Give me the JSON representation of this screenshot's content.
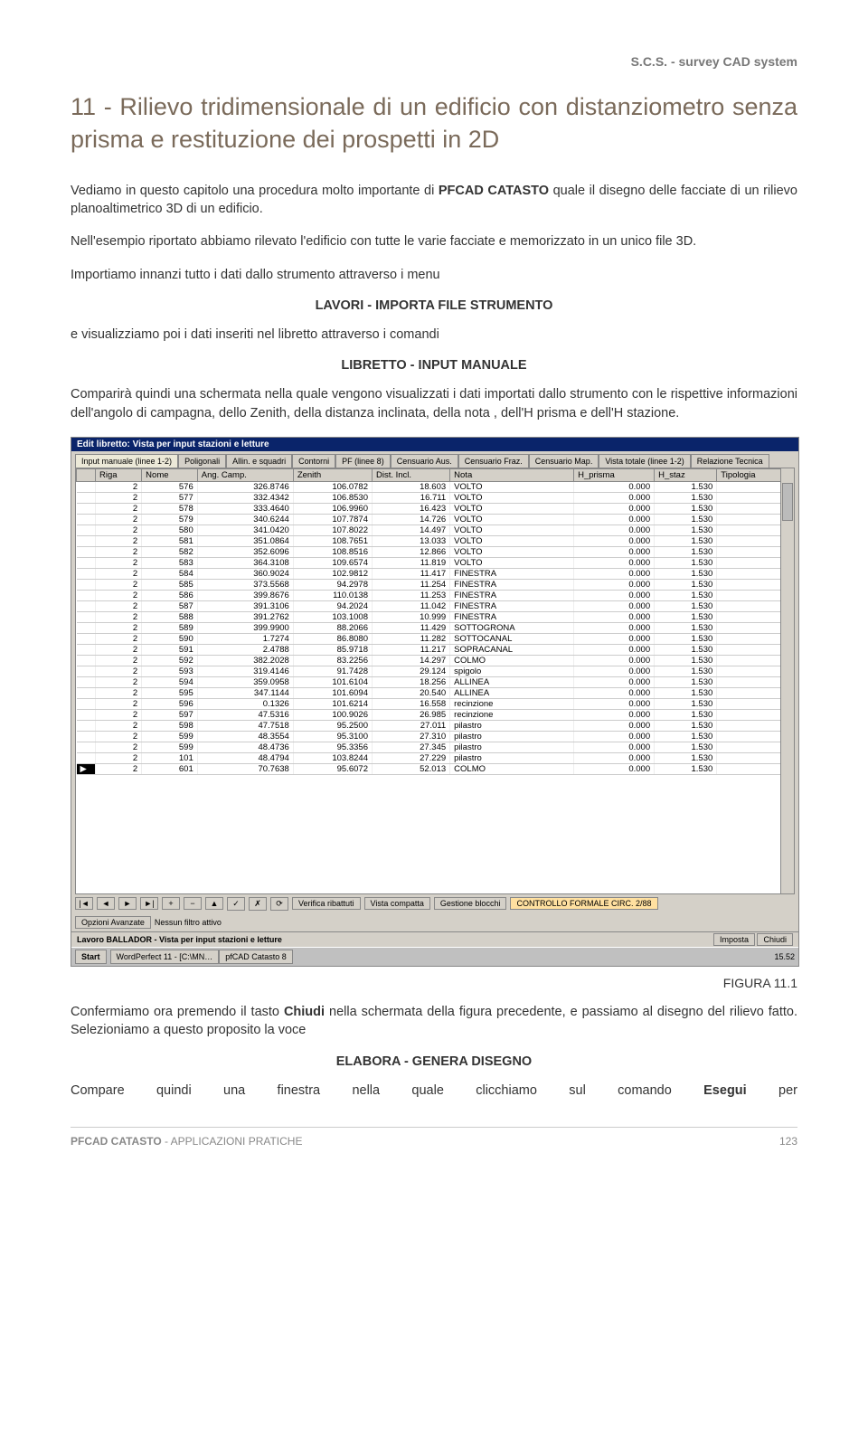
{
  "header": "S.C.S. - survey CAD system",
  "title": "11 - Rilievo tridimensionale di un edificio con distanziometro senza prisma e restituzione dei prospetti in 2D",
  "para1_a": "Vediamo in questo capitolo una procedura molto importante di ",
  "para1_b": "PFCAD CATASTO",
  "para1_c": " quale il disegno delle facciate di un rilievo planoaltimetrico 3D di un edificio.",
  "para2": "Nell'esempio riportato abbiamo rilevato l'edificio con tutte le varie facciate e memorizzato in un unico file 3D.",
  "para3": "Importiamo innanzi tutto i dati dallo strumento attraverso i menu",
  "center1": "LAVORI - IMPORTA FILE STRUMENTO",
  "para4": "e visualizziamo poi i dati inseriti nel libretto attraverso i comandi",
  "center2": "LIBRETTO - INPUT MANUALE",
  "para5": "Comparirà quindi una schermata nella quale vengono visualizzati i dati importati dallo strumento con le rispettive informazioni dell'angolo di campagna, dello Zenith, della distanza inclinata, della nota , dell'H prisma e dell'H stazione.",
  "figure_caption": "FIGURA 11.1",
  "para6_a": "Confermiamo ora premendo il tasto ",
  "para6_b": "Chiudi",
  "para6_c": " nella schermata della figura precedente, e passiamo al disegno del rilievo fatto.  Selezioniamo a questo proposito la voce",
  "center3": "ELABORA - GENERA DISEGNO",
  "para7_a": "Compare quindi una finestra nella quale clicchiamo sul comando ",
  "para7_b": "Esegui",
  "para7_c": " per",
  "footer_left_a": "PFCAD CATASTO",
  "footer_left_b": " - APPLICAZIONI PRATICHE",
  "footer_right": "123",
  "screenshot": {
    "window_title": "Edit libretto: Vista per input stazioni e letture",
    "tabs": [
      "Input manuale (linee 1-2)",
      "Poligonali",
      "Allin. e squadri",
      "Contorni",
      "PF (linee 8)",
      "Censuario Aus.",
      "Censuario Fraz.",
      "Censuario Map.",
      "Vista totale (linee 1-2)",
      "Relazione Tecnica"
    ],
    "columns": [
      "Riga",
      "Nome",
      "Ang. Camp.",
      "Zenith",
      "Dist. Incl.",
      "Nota",
      "H_prisma",
      "H_staz",
      "Tipologia"
    ],
    "rows": [
      [
        "2",
        "576",
        "326.8746",
        "106.0782",
        "18.603",
        "VOLTO",
        "0.000",
        "1.530",
        ""
      ],
      [
        "2",
        "577",
        "332.4342",
        "106.8530",
        "16.711",
        "VOLTO",
        "0.000",
        "1.530",
        ""
      ],
      [
        "2",
        "578",
        "333.4640",
        "106.9960",
        "16.423",
        "VOLTO",
        "0.000",
        "1.530",
        ""
      ],
      [
        "2",
        "579",
        "340.6244",
        "107.7874",
        "14.726",
        "VOLTO",
        "0.000",
        "1.530",
        ""
      ],
      [
        "2",
        "580",
        "341.0420",
        "107.8022",
        "14.497",
        "VOLTO",
        "0.000",
        "1.530",
        ""
      ],
      [
        "2",
        "581",
        "351.0864",
        "108.7651",
        "13.033",
        "VOLTO",
        "0.000",
        "1.530",
        ""
      ],
      [
        "2",
        "582",
        "352.6096",
        "108.8516",
        "12.866",
        "VOLTO",
        "0.000",
        "1.530",
        ""
      ],
      [
        "2",
        "583",
        "364.3108",
        "109.6574",
        "11.819",
        "VOLTO",
        "0.000",
        "1.530",
        ""
      ],
      [
        "2",
        "584",
        "360.9024",
        "102.9812",
        "11.417",
        "FINESTRA",
        "0.000",
        "1.530",
        ""
      ],
      [
        "2",
        "585",
        "373.5568",
        "94.2978",
        "11.254",
        "FINESTRA",
        "0.000",
        "1.530",
        ""
      ],
      [
        "2",
        "586",
        "399.8676",
        "110.0138",
        "11.253",
        "FINESTRA",
        "0.000",
        "1.530",
        ""
      ],
      [
        "2",
        "587",
        "391.3106",
        "94.2024",
        "11.042",
        "FINESTRA",
        "0.000",
        "1.530",
        ""
      ],
      [
        "2",
        "588",
        "391.2762",
        "103.1008",
        "10.999",
        "FINESTRA",
        "0.000",
        "1.530",
        ""
      ],
      [
        "2",
        "589",
        "399.9900",
        "88.2066",
        "11.429",
        "SOTTOGRONA",
        "0.000",
        "1.530",
        ""
      ],
      [
        "2",
        "590",
        "1.7274",
        "86.8080",
        "11.282",
        "SOTTOCANAL",
        "0.000",
        "1.530",
        ""
      ],
      [
        "2",
        "591",
        "2.4788",
        "85.9718",
        "11.217",
        "SOPRACANAL",
        "0.000",
        "1.530",
        ""
      ],
      [
        "2",
        "592",
        "382.2028",
        "83.2256",
        "14.297",
        "COLMO",
        "0.000",
        "1.530",
        ""
      ],
      [
        "2",
        "593",
        "319.4146",
        "91.7428",
        "29.124",
        "spigolo",
        "0.000",
        "1.530",
        ""
      ],
      [
        "2",
        "594",
        "359.0958",
        "101.6104",
        "18.256",
        "ALLINEA",
        "0.000",
        "1.530",
        ""
      ],
      [
        "2",
        "595",
        "347.1144",
        "101.6094",
        "20.540",
        "ALLINEA",
        "0.000",
        "1.530",
        ""
      ],
      [
        "2",
        "596",
        "0.1326",
        "101.6214",
        "16.558",
        "recinzione",
        "0.000",
        "1.530",
        ""
      ],
      [
        "2",
        "597",
        "47.5316",
        "100.9026",
        "26.985",
        "recinzione",
        "0.000",
        "1.530",
        ""
      ],
      [
        "2",
        "598",
        "47.7518",
        "95.2500",
        "27.011",
        "pilastro",
        "0.000",
        "1.530",
        ""
      ],
      [
        "2",
        "599",
        "48.3554",
        "95.3100",
        "27.310",
        "pilastro",
        "0.000",
        "1.530",
        ""
      ],
      [
        "2",
        "599",
        "48.4736",
        "95.3356",
        "27.345",
        "pilastro",
        "0.000",
        "1.530",
        ""
      ],
      [
        "2",
        "101",
        "48.4794",
        "103.8244",
        "27.229",
        "pilastro",
        "0.000",
        "1.530",
        ""
      ],
      [
        "2",
        "601",
        "70.7638",
        "95.6072",
        "52.013",
        "COLMO",
        "0.000",
        "1.530",
        ""
      ]
    ],
    "nav_buttons": [
      "|◄",
      "◄",
      "►",
      "►|",
      "+",
      "−",
      "▲",
      "✓",
      "✗",
      "⟳"
    ],
    "nav_labels": [
      "Verifica ribattuti",
      "Vista compatta",
      "Gestione blocchi",
      "CONTROLLO FORMALE CIRC. 2/88"
    ],
    "opzioni": "Opzioni Avanzate",
    "filtro": "Nessun filtro attivo",
    "status_left": "Lavoro BALLADOR - Vista per input stazioni e letture",
    "btn_imposta": "Imposta",
    "btn_chiudi": "Chiudi",
    "taskbar": {
      "start": "Start",
      "apps": [
        "WordPerfect 11 - [C:\\MN…",
        "pfCAD Catasto 8"
      ],
      "time": "15.52"
    }
  }
}
